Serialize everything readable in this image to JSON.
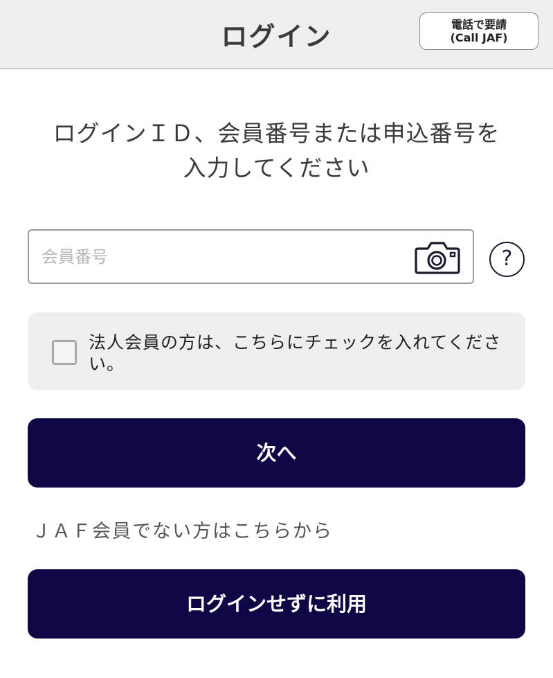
{
  "header": {
    "title": "ログイン",
    "call_button": {
      "line1": "電話で要請",
      "line2": "(Call JAF)"
    }
  },
  "instruction": {
    "line1": "ログインＩＤ、会員番号または申込番号を",
    "line2": "入力してください"
  },
  "member_id_field": {
    "placeholder": "会員番号",
    "value": "",
    "camera_icon": "camera-icon"
  },
  "help_button": {
    "label": "?",
    "icon": "help-icon"
  },
  "corporate_member": {
    "checked": false,
    "label": "法人会員の方は、こちらにチェックを入れてください。"
  },
  "next_button": {
    "label": "次へ"
  },
  "non_member_link": {
    "label": "ＪＡＦ会員でない方はこちらから"
  },
  "guest_button": {
    "label": "ログインせずに利用"
  },
  "colors": {
    "header_bg": "#efefef",
    "primary": "#0d0845",
    "panel_bg": "#efefef"
  }
}
